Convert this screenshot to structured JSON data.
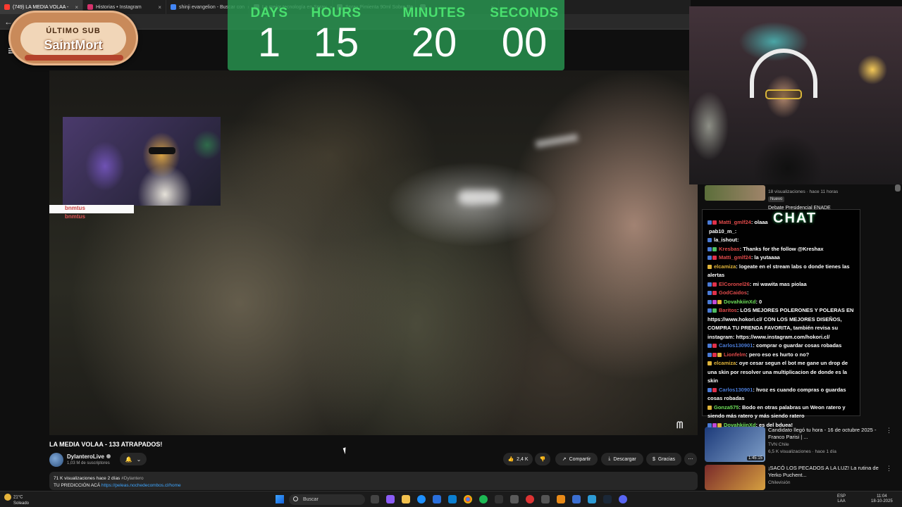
{
  "browser": {
    "tabs": [
      {
        "label": "(749) LA MEDIA VOLAA - ",
        "color": "#ff3b30",
        "active": true
      },
      {
        "label": "Historias • Instagram",
        "color": "#d6336c",
        "active": false
      },
      {
        "label": "shinji evangelion - Buscar con",
        "color": "#4285f4",
        "active": false
      },
      {
        "label": "La mejor tecnología en Spray",
        "color": "#888888",
        "active": false
      },
      {
        "label": "Spray Pimienta 90ml Sobre Re",
        "color": "#888888",
        "active": false
      },
      {
        "label": "",
        "color": "#888888",
        "active": false
      }
    ]
  },
  "sub_badge": {
    "label": "ÚLTIMO SUB",
    "name": "SaintMort"
  },
  "countdown": {
    "units": [
      {
        "label": "DAYS",
        "value": "1"
      },
      {
        "label": "HOURS",
        "value": "15"
      },
      {
        "label": "MINUTES",
        "value": "20"
      },
      {
        "label": "SECONDS",
        "value": "00"
      }
    ]
  },
  "facecam_chat": [
    "bnmtus",
    "bnmtus"
  ],
  "video": {
    "title": "LA MEDIA VOLAA - 133 ATRAPADOS!",
    "channel": "DylanteroLive",
    "subscribers": "1,03 M de suscriptores",
    "likes": "2,4 K",
    "share": "Compartir",
    "download": "Descargar",
    "thanks": "Gracias",
    "desc_stats": "71 K visualizaciones  hace 2 días",
    "desc_tag": "#Dylantero",
    "desc_line2_prefix": "TU PREDICCIÓN ACÁ",
    "desc_link": "https://peleas.nochedecombos.cl/home"
  },
  "chat": {
    "title": "CHAT",
    "messages": [
      {
        "user": "Matti_gmlf24",
        "color": "#e04a4a",
        "text": ": olaaa",
        "badges": [
          "#4a7bd6",
          "#e0304a"
        ]
      },
      {
        "user": "pab10_m_",
        "color": "#ffffff",
        "text": ": ",
        "badges": []
      },
      {
        "user": "la_ishout",
        "color": "#ffffff",
        "text": ": ",
        "badges": [
          "#4a7bd6"
        ]
      },
      {
        "user": "Kresbas",
        "color": "#e04a4a",
        "text": ": Thanks for the follow @Kreshax",
        "badges": [
          "#4a7bd6",
          "#4fbf64"
        ]
      },
      {
        "user": "Matti_gmlf24",
        "color": "#e04a4a",
        "text": ": la yutaaaa",
        "badges": [
          "#4a7bd6",
          "#e0304a"
        ]
      },
      {
        "user": "elcamiza",
        "color": "#e0b43a",
        "text": ": logeate en el stream labs o donde tienes las alertas",
        "badges": [
          "#e0b43a"
        ]
      },
      {
        "user": "ElCoronel26",
        "color": "#e04a4a",
        "text": ": mi wawita mas piolaa",
        "badges": [
          "#4a7bd6",
          "#e0304a"
        ]
      },
      {
        "user": "GodCaidos",
        "color": "#e04a4a",
        "text": ": ",
        "badges": [
          "#4a7bd6",
          "#e0304a"
        ]
      },
      {
        "user": "DovahkiinXd",
        "color": "#6ee05a",
        "text": ": 0",
        "badges": [
          "#4a7bd6",
          "#c24ad6",
          "#e0b43a"
        ]
      },
      {
        "user": "Baritos",
        "color": "#e04a4a",
        "text": ": LOS MEJORES POLERONES Y POLERAS EN https://www.hokori.cl/ CON LOS MEJORES DISEÑOS, COMPRA TU PRENDA FAVORITA, también revisa su instagram: https://www.instagram.com/hokori.cl/",
        "badges": [
          "#4a7bd6",
          "#4fbf64"
        ]
      },
      {
        "user": "Carlos130901",
        "color": "#4a7bd6",
        "text": ": comprar o guardar cosas robadas",
        "badges": [
          "#4a7bd6",
          "#e0304a"
        ]
      },
      {
        "user": "Lionfelm",
        "color": "#e04a4a",
        "text": ": pero eso es hurto o no?",
        "badges": [
          "#4a7bd6",
          "#e0304a",
          "#e0b43a"
        ]
      },
      {
        "user": "elcamiza",
        "color": "#e0b43a",
        "text": ": oye cesar segun el bot me gane un drop de una skin por resolver una multiplicacion de donde es la skin",
        "badges": [
          "#e0b43a"
        ]
      },
      {
        "user": "Carlos130901",
        "color": "#4a7bd6",
        "text": ": hvoz es cuando compras o guardas cosas robadas",
        "badges": [
          "#4a7bd6",
          "#e0304a"
        ]
      },
      {
        "user": "Gonza575",
        "color": "#6ee05a",
        "text": ": Bodo en otras palabras un Weon ratero y siendo más ratero y más siendo ratero",
        "badges": [
          "#e0b43a"
        ]
      },
      {
        "user": "DovahkiinXd",
        "color": "#6ee05a",
        "text": ": es del bduea!",
        "badges": [
          "#4a7bd6",
          "#c24ad6",
          "#e0b43a"
        ]
      }
    ]
  },
  "recommendations": {
    "top": {
      "meta": "18 visualizaciones · hace 11 horas",
      "badge": "Nuevo",
      "next_title": "Debate Presidencial ENADE"
    },
    "items": [
      {
        "title": "Candidato llegó tu hora - 16 de octubre 2025 - Franco Parisi | ...",
        "channel": "TVN Chile",
        "meta": "6,5 K visualizaciones · hace 1 día",
        "duration": "1:45:15"
      },
      {
        "title": "¡SACÓ LOS PECADOS A LA LUZ! La rutina de Yerko Puchent...",
        "channel": "Chilevisión",
        "meta": "",
        "duration": ""
      }
    ]
  },
  "taskbar": {
    "weather_temp": "21°C",
    "weather_desc": "Soleado",
    "search": "Buscar",
    "lang": "ESP",
    "lang2": "LAA",
    "time": "11:04",
    "date": "18-10-2025"
  }
}
